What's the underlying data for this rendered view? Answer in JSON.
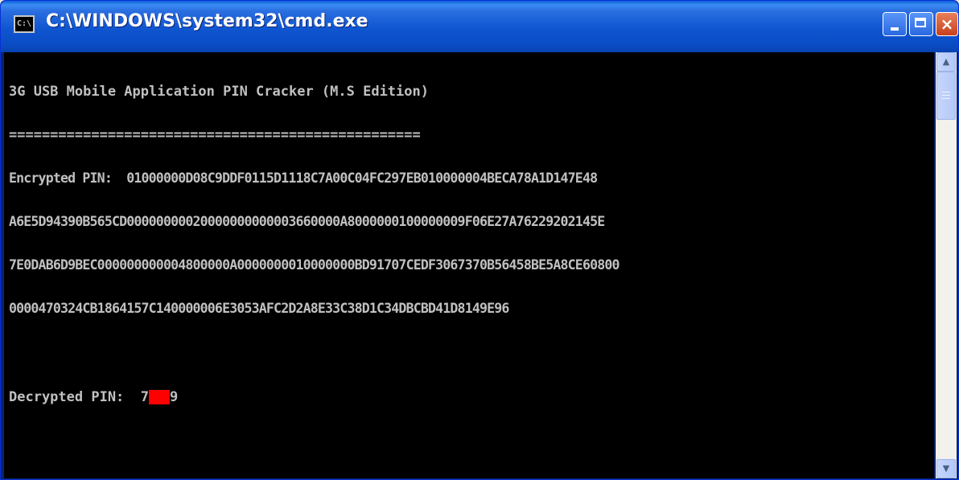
{
  "window": {
    "title": "C:\\WINDOWS\\system32\\cmd.exe",
    "app_icon_label": "C:\\",
    "controls": {
      "minimize": "minimize",
      "maximize": "maximize",
      "close": "×"
    }
  },
  "console": {
    "heading": "3G USB Mobile Application PIN Cracker (M.S Edition)",
    "separator": "==================================================",
    "encrypted_label": "Encrypted PIN:  ",
    "encrypted_lines": [
      "01000000D08C9DDF0115D1118C7A00C04FC297EB010000004BECA78A1D147E48",
      "A6E5D94390B565CD00000000020000000000003660000A8000000100000009F06E27A76229202145E",
      "7E0DAB6D9BEC000000000004800000A0000000010000000BD91707CEDF3067370B56458BE5A8CE60800",
      "0000470324CB1864157C140000006E3053AFC2D2A8E33C38D1C34DBCBD41D8149E96"
    ],
    "decrypted_label": "Decrypted PIN:  ",
    "decrypted_prefix": "7",
    "decrypted_suffix": "9",
    "redaction_color": "#ff0000"
  },
  "scrollbar": {
    "up_arrow": "▲",
    "down_arrow": "▼"
  }
}
